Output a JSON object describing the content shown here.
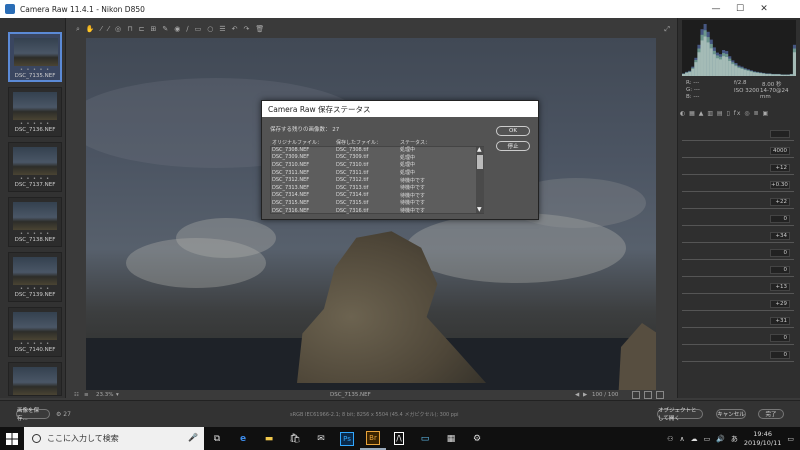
{
  "window": {
    "title": "Camera Raw 11.4.1  -  Nikon D850"
  },
  "filmstrip": {
    "thumbs": [
      {
        "name": "DSC_7135.NEF",
        "stars": "• • • • •"
      },
      {
        "name": "DSC_7136.NEF",
        "stars": "• • • • •"
      },
      {
        "name": "DSC_7137.NEF",
        "stars": "• • • • •"
      },
      {
        "name": "DSC_7138.NEF",
        "stars": "• • • • •"
      },
      {
        "name": "DSC_7139.NEF",
        "stars": "• • • • •"
      },
      {
        "name": "DSC_7140.NEF",
        "stars": "• • • • •"
      }
    ]
  },
  "status": {
    "zoom": "23.3%",
    "filename": "DSC_7135.NEF",
    "counter": "100 / 100"
  },
  "histogram": {
    "values": [
      0.05,
      0.08,
      0.1,
      0.18,
      0.35,
      0.6,
      0.9,
      1.0,
      0.85,
      0.7,
      0.55,
      0.45,
      0.42,
      0.5,
      0.48,
      0.38,
      0.3,
      0.25,
      0.2,
      0.18,
      0.15,
      0.13,
      0.11,
      0.09,
      0.08,
      0.07,
      0.06,
      0.05,
      0.05,
      0.04,
      0.04,
      0.04,
      0.03,
      0.03,
      0.03,
      0.04,
      0.6
    ],
    "colors": [
      "#7aa0ff",
      "#9be29b",
      "#e8e8e8"
    ]
  },
  "info": {
    "fstop": "f/2.8",
    "shutter": "8.00 秒",
    "iso": "ISO 3200",
    "lens": "14-70@24 mm"
  },
  "panel": {
    "rows": [
      {
        "label": "",
        "value": ""
      },
      {
        "label": "",
        "value": "4000"
      },
      {
        "label": "",
        "value": "+12"
      },
      {
        "label": "",
        "value": "+0.30"
      },
      {
        "label": "",
        "value": "+22"
      },
      {
        "label": "",
        "value": "0"
      },
      {
        "label": "",
        "value": "+34"
      },
      {
        "label": "",
        "value": "0"
      },
      {
        "label": "",
        "value": "0"
      },
      {
        "label": "",
        "value": "+13"
      },
      {
        "label": "",
        "value": "+29"
      },
      {
        "label": "",
        "value": "+31"
      },
      {
        "label": "",
        "value": "0"
      },
      {
        "label": "",
        "value": "0"
      }
    ]
  },
  "dialog": {
    "title": "Camera Raw 保存ステータス",
    "remaining_label": "保存する残りの画像数：",
    "remaining_count": "27",
    "columns": [
      "オリジナルファイル：",
      "保存したファイル：",
      "ステータス："
    ],
    "rows": [
      [
        "DSC_7308.NEF",
        "DSC_7308.tif",
        "処理中"
      ],
      [
        "DSC_7309.NEF",
        "DSC_7309.tif",
        "処理中"
      ],
      [
        "DSC_7310.NEF",
        "DSC_7310.tif",
        "処理中"
      ],
      [
        "DSC_7311.NEF",
        "DSC_7311.tif",
        "処理中"
      ],
      [
        "DSC_7312.NEF",
        "DSC_7312.tif",
        "待機中です"
      ],
      [
        "DSC_7313.NEF",
        "DSC_7313.tif",
        "待機中です"
      ],
      [
        "DSC_7314.NEF",
        "DSC_7314.tif",
        "待機中です"
      ],
      [
        "DSC_7315.NEF",
        "DSC_7315.tif",
        "待機中です"
      ],
      [
        "DSC_7316.NEF",
        "DSC_7316.tif",
        "待機中です"
      ]
    ],
    "ok_label": "OK",
    "stop_label": "停止"
  },
  "bottom": {
    "save_label": "画像を保存...",
    "cancel_label": "キャンセル",
    "done_label": "完了",
    "open_label": "オブジェクトとして開く",
    "workflow": "sRGB IEC61966-2.1; 8 bit; 8256 x 5504 (45.4 メガピクセル); 300 ppi"
  },
  "taskbar": {
    "search_placeholder": "ここに入力して検索",
    "time": "19:46",
    "date": "2019/10/11",
    "ime": "あ"
  }
}
